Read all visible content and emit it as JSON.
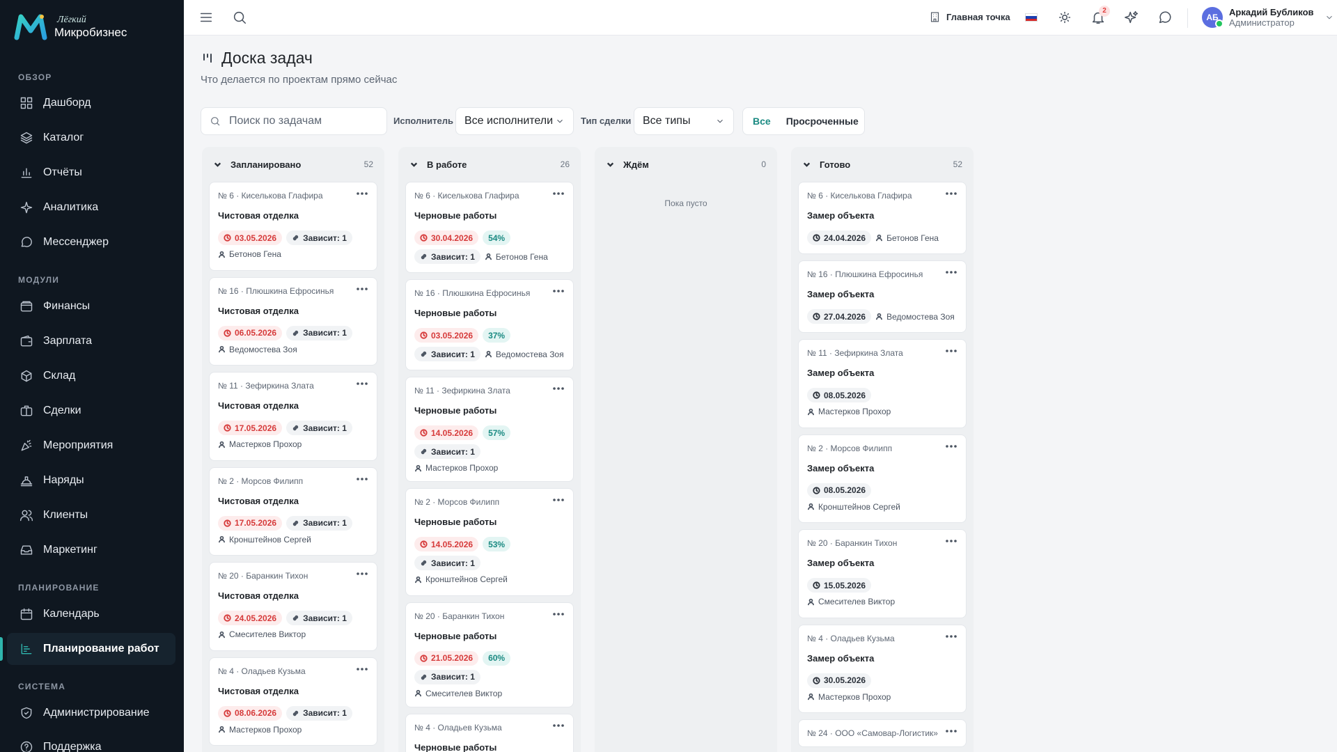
{
  "brand": {
    "line1": "Лёгкий",
    "line2": "Микробизнес"
  },
  "sidebar": {
    "sections": [
      {
        "title": "ОБЗОР",
        "items": [
          {
            "label": "Дашборд",
            "icon": "dashboard-icon"
          },
          {
            "label": "Каталог",
            "icon": "catalog-icon"
          },
          {
            "label": "Отчёты",
            "icon": "reports-icon"
          },
          {
            "label": "Аналитика",
            "icon": "analytics-icon"
          },
          {
            "label": "Мессенджер",
            "icon": "messenger-icon"
          }
        ]
      },
      {
        "title": "МОДУЛИ",
        "items": [
          {
            "label": "Финансы",
            "icon": "finance-icon"
          },
          {
            "label": "Зарплата",
            "icon": "salary-icon"
          },
          {
            "label": "Склад",
            "icon": "warehouse-icon"
          },
          {
            "label": "Сделки",
            "icon": "deals-icon"
          },
          {
            "label": "Мероприятия",
            "icon": "events-icon"
          },
          {
            "label": "Наряды",
            "icon": "orders-icon"
          },
          {
            "label": "Клиенты",
            "icon": "clients-icon"
          },
          {
            "label": "Маркетинг",
            "icon": "marketing-icon"
          }
        ]
      },
      {
        "title": "ПЛАНИРОВАНИЕ",
        "items": [
          {
            "label": "Календарь",
            "icon": "calendar-icon"
          },
          {
            "label": "Планирование работ",
            "icon": "planning-icon",
            "active": true
          }
        ]
      },
      {
        "title": "СИСТЕМА",
        "items": [
          {
            "label": "Администрирование",
            "icon": "admin-icon"
          },
          {
            "label": "Поддержка",
            "icon": "support-icon"
          }
        ]
      }
    ]
  },
  "topbar": {
    "location": "Главная точка",
    "notifications_count": "2",
    "user": {
      "initials": "АБ",
      "name": "Аркадий Бубликов",
      "role": "Администратор"
    }
  },
  "page": {
    "title": "Доска задач",
    "subtitle": "Что делается по проектам прямо сейчас"
  },
  "filters": {
    "search_placeholder": "Поиск по задачам",
    "assignee_label": "Исполнитель",
    "assignee_value": "Все исполнители",
    "dealtype_label": "Тип сделки",
    "dealtype_value": "Все типы",
    "toggle_all": "Все",
    "toggle_overdue": "Просроченные"
  },
  "columns": [
    {
      "title": "Запланировано",
      "count": "52",
      "cards": [
        {
          "meta": "№ 6 · Киселькова Глафира",
          "title": "Чистовая отделка",
          "date": "03.05.2026",
          "overdue": true,
          "dep": "Зависит: 1",
          "person": "Бетонов Гена"
        },
        {
          "meta": "№ 16 · Плюшкина Ефросинья",
          "title": "Чистовая отделка",
          "date": "06.05.2026",
          "overdue": true,
          "dep": "Зависит: 1",
          "person": "Ведомостева Зоя"
        },
        {
          "meta": "№ 11 · Зефиркина Злата",
          "title": "Чистовая отделка",
          "date": "17.05.2026",
          "overdue": true,
          "dep": "Зависит: 1",
          "person": "Мастерков Прохор"
        },
        {
          "meta": "№ 2 · Морсов Филипп",
          "title": "Чистовая отделка",
          "date": "17.05.2026",
          "overdue": true,
          "dep": "Зависит: 1",
          "person": "Кронштейнов Сергей"
        },
        {
          "meta": "№ 20 · Баранкин Тихон",
          "title": "Чистовая отделка",
          "date": "24.05.2026",
          "overdue": true,
          "dep": "Зависит: 1",
          "person": "Смесителев Виктор"
        },
        {
          "meta": "№ 4 · Оладьев Кузьма",
          "title": "Чистовая отделка",
          "date": "08.06.2026",
          "overdue": true,
          "dep": "Зависит: 1",
          "person": "Мастерков Прохор"
        }
      ]
    },
    {
      "title": "В работе",
      "count": "26",
      "cards": [
        {
          "meta": "№ 6 · Киселькова Глафира",
          "title": "Черновые работы",
          "date": "30.04.2026",
          "overdue": true,
          "pct": "54%",
          "dep": "Зависит: 1",
          "person": "Бетонов Гена"
        },
        {
          "meta": "№ 16 · Плюшкина Ефросинья",
          "title": "Черновые работы",
          "date": "03.05.2026",
          "overdue": true,
          "pct": "37%",
          "dep": "Зависит: 1",
          "person": "Ведомостева Зоя"
        },
        {
          "meta": "№ 11 · Зефиркина Злата",
          "title": "Черновые работы",
          "date": "14.05.2026",
          "overdue": true,
          "pct": "57%",
          "dep": "Зависит: 1",
          "person": "Мастерков Прохор"
        },
        {
          "meta": "№ 2 · Морсов Филипп",
          "title": "Черновые работы",
          "date": "14.05.2026",
          "overdue": true,
          "pct": "53%",
          "dep": "Зависит: 1",
          "person": "Кронштейнов Сергей",
          "person_newline": true
        },
        {
          "meta": "№ 20 · Баранкин Тихон",
          "title": "Черновые работы",
          "date": "21.05.2026",
          "overdue": true,
          "pct": "60%",
          "dep": "Зависит: 1",
          "person": "Смесителев Виктор"
        },
        {
          "meta": "№ 4 · Оладьев Кузьма",
          "title": "Черновые работы"
        }
      ]
    },
    {
      "title": "Ждём",
      "count": "0",
      "empty": "Пока пусто",
      "cards": []
    },
    {
      "title": "Готово",
      "count": "52",
      "cards": [
        {
          "meta": "№ 6 · Киселькова Глафира",
          "title": "Замер объекта",
          "date": "24.04.2026",
          "overdue": false,
          "person": "Бетонов Гена",
          "person_inline": true
        },
        {
          "meta": "№ 16 · Плюшкина Ефросинья",
          "title": "Замер объекта",
          "date": "27.04.2026",
          "overdue": false,
          "person": "Ведомостева Зоя",
          "person_inline": true
        },
        {
          "meta": "№ 11 · Зефиркина Злата",
          "title": "Замер объекта",
          "date": "08.05.2026",
          "overdue": false,
          "person": "Мастерков Прохор"
        },
        {
          "meta": "№ 2 · Морсов Филипп",
          "title": "Замер объекта",
          "date": "08.05.2026",
          "overdue": false,
          "person": "Кронштейнов Сергей"
        },
        {
          "meta": "№ 20 · Баранкин Тихон",
          "title": "Замер объекта",
          "date": "15.05.2026",
          "overdue": false,
          "person": "Смесителев Виктор"
        },
        {
          "meta": "№ 4 · Оладьев Кузьма",
          "title": "Замер объекта",
          "date": "30.05.2026",
          "overdue": false,
          "person": "Мастерков Прохор"
        },
        {
          "meta": "№ 24 · ООО «Самовар-Логистик»"
        }
      ]
    }
  ]
}
